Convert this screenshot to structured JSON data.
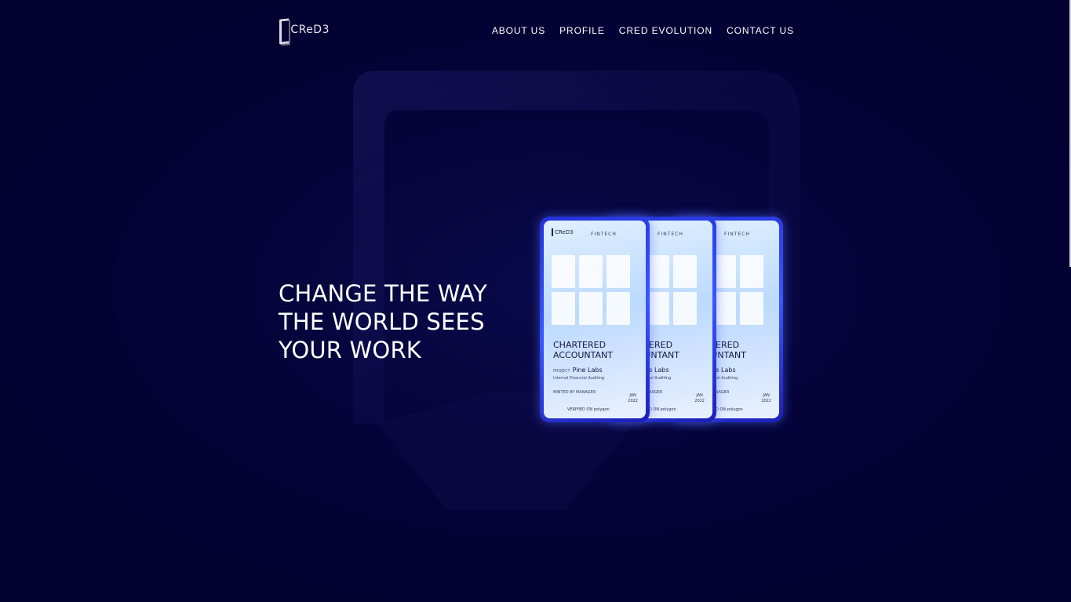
{
  "brand": {
    "logo_text": "CReD3"
  },
  "nav": {
    "items": [
      "ABOUT US",
      "PROFILE",
      "CRED EVOLUTION",
      "CONTACT US"
    ]
  },
  "hero": {
    "lines": [
      "CHANGE THE WAY",
      "THE WORLD SEES",
      "YOUR WORK"
    ]
  },
  "card": {
    "logo": "CReD3",
    "category": "FINTECH",
    "title_line1": "CHARTERED",
    "title_line2": "ACCOUNTANT",
    "project_label": "PROJECT",
    "project_name": "Pine Labs",
    "description": "Internal Financial Auditing",
    "minted": "MINTED BY MANAGER",
    "date_month": "JAN",
    "date_year": "2022",
    "verified": "VERIFIED ON polygon"
  },
  "colors": {
    "background": "#030130",
    "card_frame": "#2f48ff",
    "text": "#ffffff"
  }
}
